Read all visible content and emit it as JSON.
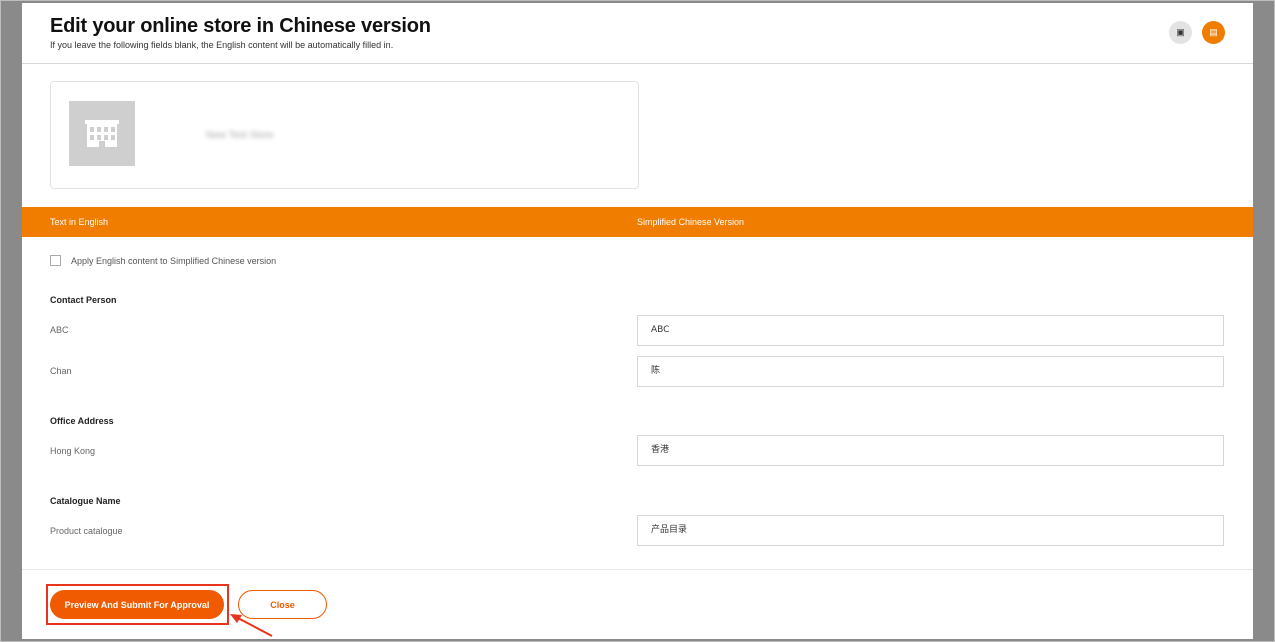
{
  "header": {
    "title": "Edit your online store in Chinese version",
    "subtitle": "If you leave the following fields blank, the English content will be automatically filled in.",
    "icon_left": "▣",
    "icon_right": "▤"
  },
  "store": {
    "name_blurred": "New Test Store"
  },
  "columns": {
    "english": "Text in English",
    "chinese": "Simplified Chinese Version"
  },
  "apply": {
    "label": "Apply English content to Simplified Chinese version",
    "checked": false
  },
  "sections": {
    "contact_person": {
      "label": "Contact Person",
      "first_en": "ABC",
      "first_zh": "ABC",
      "last_en": "Chan",
      "last_zh": "陈"
    },
    "office_address": {
      "label": "Office Address",
      "en": "Hong Kong",
      "zh": "香港"
    },
    "catalogue_name": {
      "label": "Catalogue Name",
      "en": "Product catalogue",
      "zh": "产品目录"
    }
  },
  "footer": {
    "submit_label": "Preview And Submit For Approval",
    "close_label": "Close"
  },
  "colors": {
    "accent": "#f07c00",
    "button": "#f05a00",
    "highlight": "#e8341c"
  }
}
